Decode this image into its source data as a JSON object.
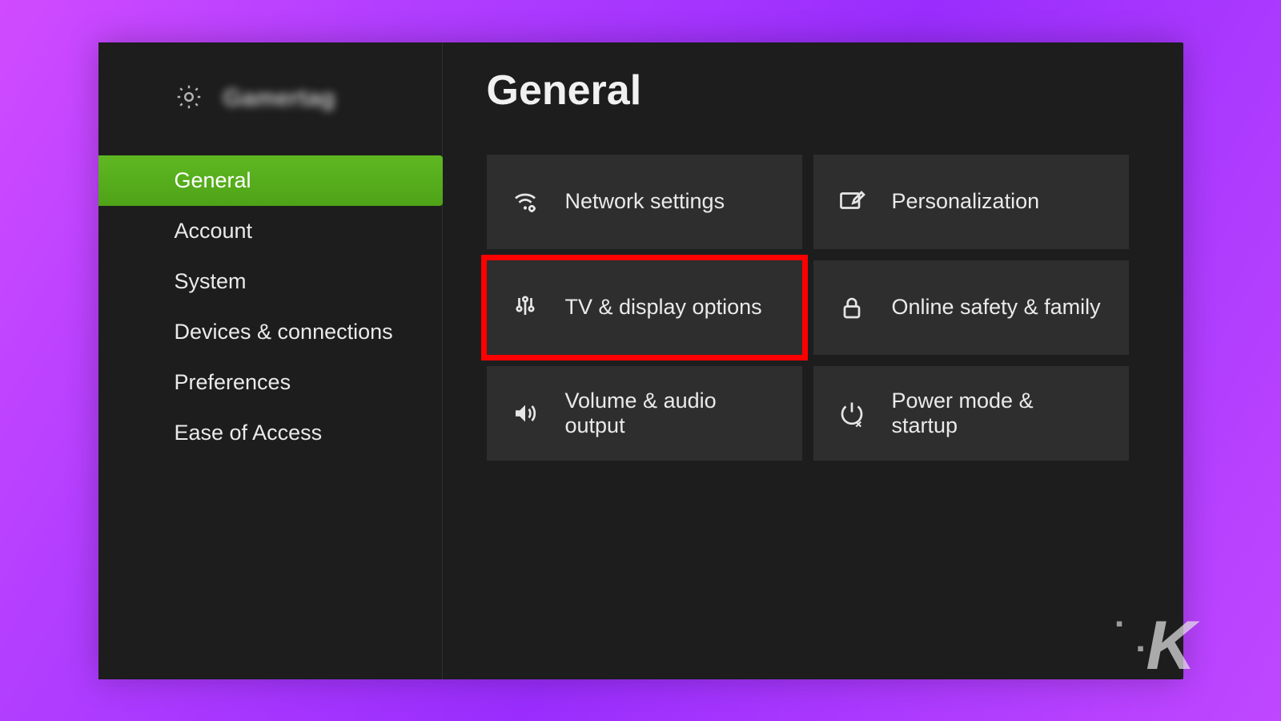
{
  "sidebar": {
    "username": "Gamertag",
    "items": [
      {
        "label": "General",
        "selected": true
      },
      {
        "label": "Account",
        "selected": false
      },
      {
        "label": "System",
        "selected": false
      },
      {
        "label": "Devices & connections",
        "selected": false
      },
      {
        "label": "Preferences",
        "selected": false
      },
      {
        "label": "Ease of Access",
        "selected": false
      }
    ]
  },
  "main": {
    "title": "General",
    "tiles": [
      {
        "label": "Network settings",
        "icon": "network-icon",
        "highlight": false
      },
      {
        "label": "Personalization",
        "icon": "personalize-icon",
        "highlight": false
      },
      {
        "label": "TV & display options",
        "icon": "display-icon",
        "highlight": true
      },
      {
        "label": "Online safety & family",
        "icon": "lock-icon",
        "highlight": false
      },
      {
        "label": "Volume & audio output",
        "icon": "volume-icon",
        "highlight": false
      },
      {
        "label": "Power mode & startup",
        "icon": "power-icon",
        "highlight": false
      }
    ]
  },
  "watermark": "K"
}
